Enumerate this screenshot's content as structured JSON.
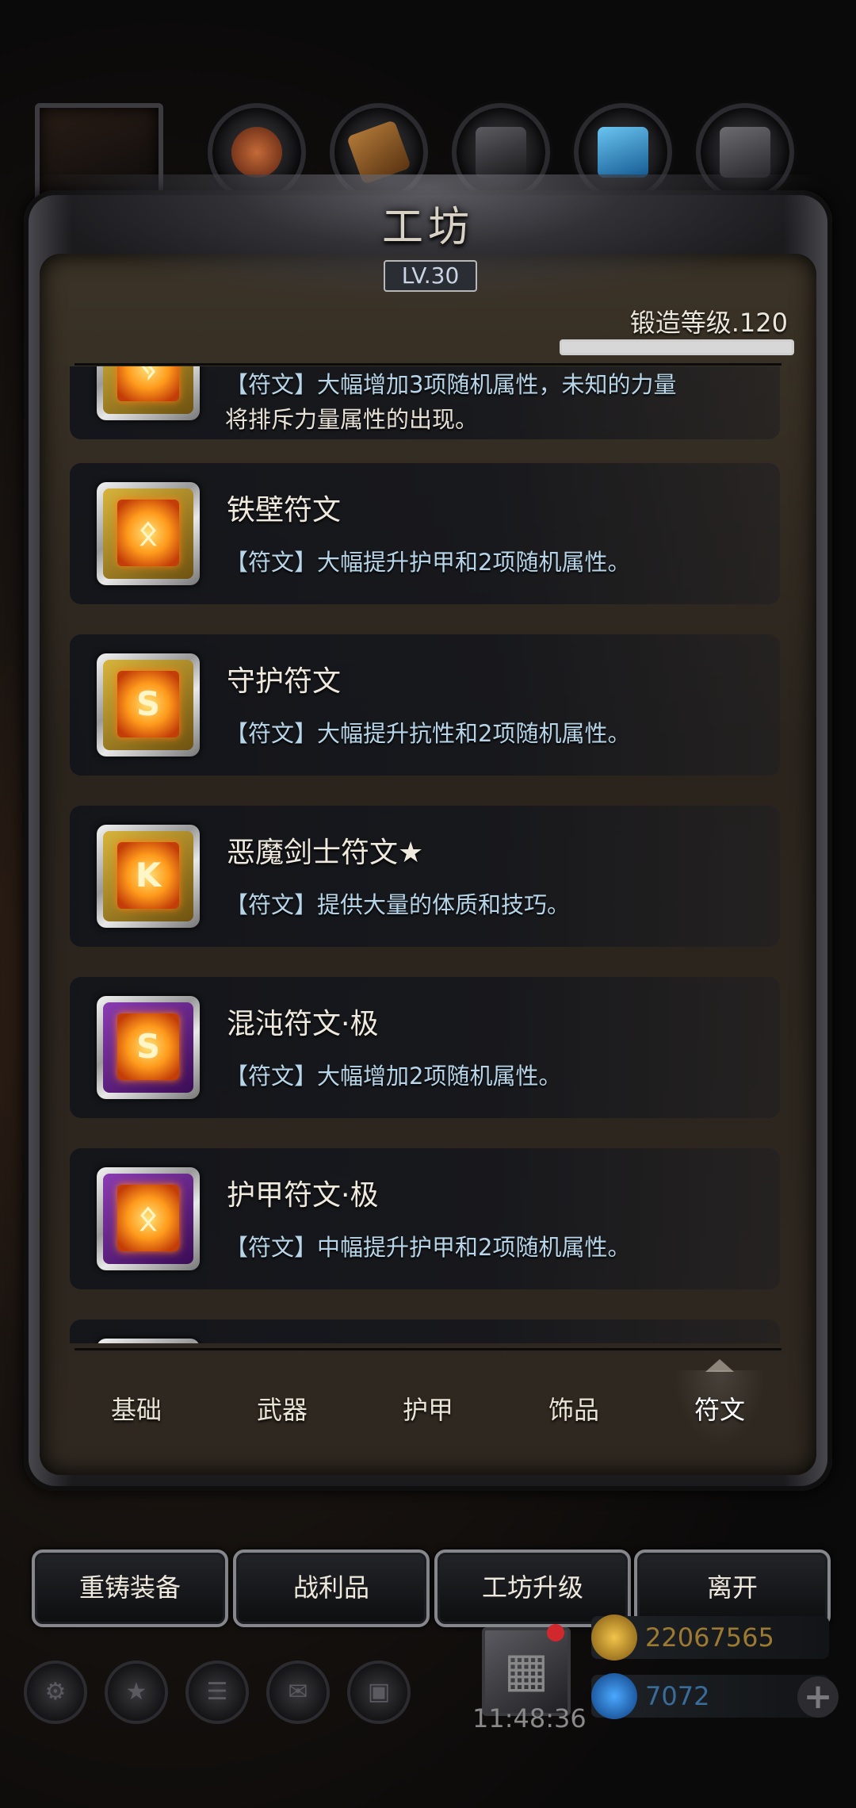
{
  "top_icons": [
    "hero-portrait-icon",
    "ore-icon",
    "wood-icon",
    "iron-icon",
    "crystal-icon",
    "stone-icon"
  ],
  "header": {
    "title": "工坊",
    "level": "LV.30",
    "forge_level": "锻造等级.120",
    "forge_progress": 1.0
  },
  "runes": [
    {
      "name": "",
      "desc": "【符文】大幅增加3项随机属性，未知的力量",
      "desc2": "将排斥力量属性的出现。",
      "frame": "gold",
      "glyph": "ᛃ"
    },
    {
      "name": "铁壁符文",
      "desc": "【符文】大幅提升护甲和2项随机属性。",
      "frame": "gold",
      "glyph": "ᛟ"
    },
    {
      "name": "守护符文",
      "desc": "【符文】大幅提升抗性和2项随机属性。",
      "frame": "gold",
      "glyph": "S"
    },
    {
      "name": "恶魔剑士符文★",
      "desc": "【符文】提供大量的体质和技巧。",
      "frame": "gold",
      "glyph": "K"
    },
    {
      "name": "混沌符文·极",
      "desc": "【符文】大幅增加2项随机属性。",
      "frame": "purple",
      "glyph": "S"
    },
    {
      "name": "护甲符文·极",
      "desc": "【符文】中幅提升护甲和2项随机属性。",
      "frame": "purple",
      "glyph": "ᛟ"
    }
  ],
  "tabs": [
    "基础",
    "武器",
    "护甲",
    "饰品",
    "符文"
  ],
  "active_tab": "符文",
  "buttons": {
    "reforge": "重铸装备",
    "loot": "战利品",
    "upgrade": "工坊升级",
    "leave": "离开"
  },
  "hud": {
    "time": "11:48:36",
    "gold": "22067565",
    "gems": "7072",
    "plus": "+"
  }
}
